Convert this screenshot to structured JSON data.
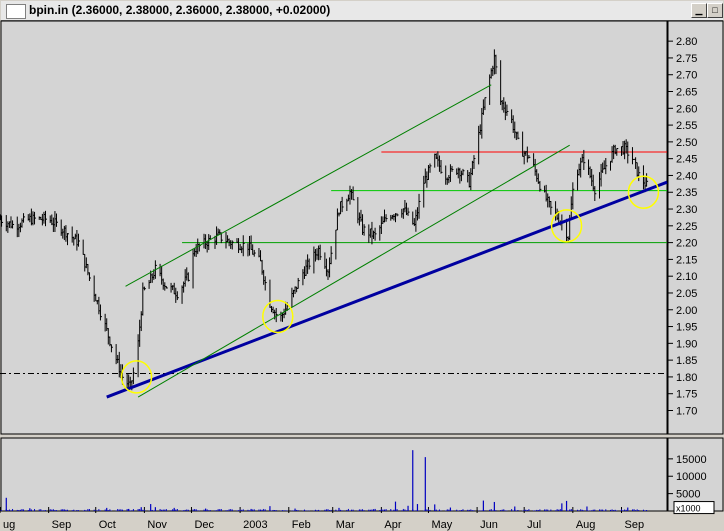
{
  "window": {
    "title": "bpin.in",
    "ohlc": "(2.36000, 2.38000, 2.36000, 2.38000, +0.02000)"
  },
  "chart_data": {
    "type": "bar",
    "symbol": "bpin.in",
    "price_axis": {
      "ylim": [
        1.63,
        2.86
      ],
      "ticks": [
        "2.80",
        "2.75",
        "2.70",
        "2.65",
        "2.60",
        "2.55",
        "2.50",
        "2.45",
        "2.40",
        "2.35",
        "2.30",
        "2.25",
        "2.20",
        "2.15",
        "2.10",
        "2.05",
        "2.00",
        "1.95",
        "1.90",
        "1.85",
        "1.80",
        "1.75",
        "1.70"
      ]
    },
    "volume_axis": {
      "ylim": [
        0,
        21000
      ],
      "ticks": [
        "15000",
        "10000",
        "5000"
      ],
      "unit": "x1000"
    },
    "x_axis": {
      "range": [
        "2002-08-01",
        "2003-09-30"
      ],
      "labels": [
        {
          "label": "ug",
          "date": "2002-08-01"
        },
        {
          "label": "Sep",
          "date": "2002-09-01"
        },
        {
          "label": "Oct",
          "date": "2002-10-01"
        },
        {
          "label": "Nov",
          "date": "2002-11-01"
        },
        {
          "label": "Dec",
          "date": "2002-12-01"
        },
        {
          "label": "2003",
          "date": "2003-01-01"
        },
        {
          "label": "Feb",
          "date": "2003-02-01"
        },
        {
          "label": "Mar",
          "date": "2003-03-01"
        },
        {
          "label": "Apr",
          "date": "2003-04-01"
        },
        {
          "label": "May",
          "date": "2003-05-01"
        },
        {
          "label": "Jun",
          "date": "2003-06-01"
        },
        {
          "label": "Jul",
          "date": "2003-07-01"
        },
        {
          "label": "Aug",
          "date": "2003-08-01"
        },
        {
          "label": "Sep",
          "date": "2003-09-01"
        }
      ]
    },
    "price_series": [
      [
        "2002-08-01",
        2.27
      ],
      [
        "2002-08-10",
        2.25
      ],
      [
        "2002-08-20",
        2.27
      ],
      [
        "2002-09-01",
        2.27
      ],
      [
        "2002-09-10",
        2.24
      ],
      [
        "2002-09-20",
        2.2
      ],
      [
        "2002-09-28",
        2.08
      ],
      [
        "2002-10-05",
        1.98
      ],
      [
        "2002-10-12",
        1.88
      ],
      [
        "2002-10-18",
        1.8
      ],
      [
        "2002-10-23",
        1.77
      ],
      [
        "2002-10-27",
        1.85
      ],
      [
        "2002-10-31",
        2.05
      ],
      [
        "2002-11-04",
        2.08
      ],
      [
        "2002-11-08",
        2.12
      ],
      [
        "2002-11-15",
        2.07
      ],
      [
        "2002-11-22",
        2.05
      ],
      [
        "2002-11-29",
        2.1
      ],
      [
        "2002-12-03",
        2.18
      ],
      [
        "2002-12-10",
        2.2
      ],
      [
        "2002-12-18",
        2.22
      ],
      [
        "2002-12-26",
        2.2
      ],
      [
        "2003-01-06",
        2.19
      ],
      [
        "2003-01-14",
        2.14
      ],
      [
        "2003-01-20",
        2.02
      ],
      [
        "2003-01-26",
        1.97
      ],
      [
        "2003-02-01",
        2.02
      ],
      [
        "2003-02-10",
        2.11
      ],
      [
        "2003-02-20",
        2.18
      ],
      [
        "2003-02-26",
        2.12
      ],
      [
        "2003-03-05",
        2.3
      ],
      [
        "2003-03-12",
        2.35
      ],
      [
        "2003-03-20",
        2.24
      ],
      [
        "2003-03-28",
        2.22
      ],
      [
        "2003-04-05",
        2.28
      ],
      [
        "2003-04-15",
        2.3
      ],
      [
        "2003-04-22",
        2.25
      ],
      [
        "2003-04-28",
        2.38
      ],
      [
        "2003-05-05",
        2.45
      ],
      [
        "2003-05-12",
        2.4
      ],
      [
        "2003-05-20",
        2.42
      ],
      [
        "2003-05-27",
        2.38
      ],
      [
        "2003-06-02",
        2.52
      ],
      [
        "2003-06-07",
        2.65
      ],
      [
        "2003-06-12",
        2.75
      ],
      [
        "2003-06-16",
        2.62
      ],
      [
        "2003-06-22",
        2.58
      ],
      [
        "2003-06-28",
        2.48
      ],
      [
        "2003-07-05",
        2.45
      ],
      [
        "2003-07-12",
        2.36
      ],
      [
        "2003-07-18",
        2.3
      ],
      [
        "2003-07-25",
        2.26
      ],
      [
        "2003-07-29",
        2.22
      ],
      [
        "2003-08-02",
        2.4
      ],
      [
        "2003-08-08",
        2.45
      ],
      [
        "2003-08-15",
        2.36
      ],
      [
        "2003-08-22",
        2.43
      ],
      [
        "2003-08-28",
        2.48
      ],
      [
        "2003-09-03",
        2.48
      ],
      [
        "2003-09-08",
        2.45
      ],
      [
        "2003-09-12",
        2.4
      ],
      [
        "2003-09-17",
        2.37
      ]
    ],
    "volume_series": [
      [
        "2002-08-05",
        3800
      ],
      [
        "2002-08-20",
        800
      ],
      [
        "2002-09-10",
        500
      ],
      [
        "2002-10-08",
        900
      ],
      [
        "2002-10-22",
        600
      ],
      [
        "2002-10-30",
        1100
      ],
      [
        "2002-11-05",
        2000
      ],
      [
        "2002-11-08",
        1100
      ],
      [
        "2002-11-20",
        900
      ],
      [
        "2002-12-10",
        700
      ],
      [
        "2003-01-08",
        600
      ],
      [
        "2003-01-20",
        1400
      ],
      [
        "2003-02-05",
        700
      ],
      [
        "2003-03-05",
        900
      ],
      [
        "2003-03-28",
        600
      ],
      [
        "2003-04-10",
        2700
      ],
      [
        "2003-04-18",
        1500
      ],
      [
        "2003-04-21",
        17500
      ],
      [
        "2003-04-24",
        2000
      ],
      [
        "2003-04-29",
        15500
      ],
      [
        "2003-05-05",
        1900
      ],
      [
        "2003-05-15",
        1000
      ],
      [
        "2003-06-05",
        3000
      ],
      [
        "2003-06-12",
        2600
      ],
      [
        "2003-06-25",
        1300
      ],
      [
        "2003-07-25",
        2200
      ],
      [
        "2003-07-28",
        2900
      ],
      [
        "2003-08-10",
        1300
      ],
      [
        "2003-09-05",
        1000
      ]
    ],
    "annotations": {
      "horizontal_lines": [
        {
          "y": 2.47,
          "from": "2003-04-01",
          "to": "2003-09-30",
          "color": "#ff0000"
        },
        {
          "y": 2.355,
          "from": "2003-02-28",
          "to": "2003-09-30",
          "color": "#00c800"
        },
        {
          "y": 2.2,
          "from": "2002-11-25",
          "to": "2003-09-30",
          "color": "#00a000"
        },
        {
          "y": 1.81,
          "from": "2002-08-01",
          "to": "2003-09-30",
          "color": "#000000",
          "style": "dashdot"
        }
      ],
      "trendlines": [
        {
          "from": [
            "2002-10-08",
            1.74
          ],
          "to": [
            "2003-09-30",
            2.38
          ],
          "color": "#0000a0",
          "width": 3
        },
        {
          "from": [
            "2002-10-28",
            1.74
          ],
          "to": [
            "2003-07-30",
            2.49
          ],
          "color": "#008000",
          "width": 1
        },
        {
          "from": [
            "2002-10-20",
            2.07
          ],
          "to": [
            "2003-06-10",
            2.67
          ],
          "color": "#008000",
          "width": 1
        }
      ],
      "circles": [
        {
          "x": "2002-10-27",
          "y": 1.8
        },
        {
          "x": "2003-01-25",
          "y": 1.98
        },
        {
          "x": "2003-07-28",
          "y": 2.25
        },
        {
          "x": "2003-09-15",
          "y": 2.35
        }
      ]
    }
  }
}
